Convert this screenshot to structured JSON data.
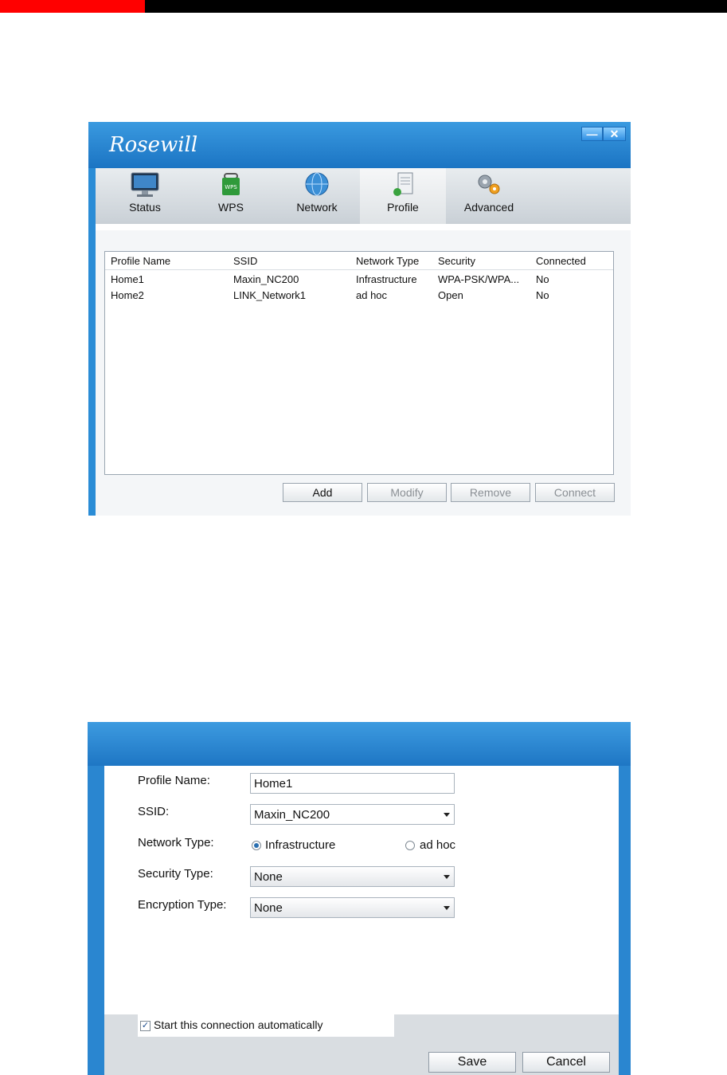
{
  "window1": {
    "brand": "Rosewill",
    "tabs": [
      {
        "label": "Status",
        "icon": "monitor-icon"
      },
      {
        "label": "WPS",
        "icon": "wps-icon"
      },
      {
        "label": "Network",
        "icon": "globe-icon"
      },
      {
        "label": "Profile",
        "icon": "profile-icon"
      },
      {
        "label": "Advanced",
        "icon": "gears-icon"
      }
    ],
    "active_tab": "Profile",
    "columns": [
      "Profile Name",
      "SSID",
      "Network Type",
      "Security",
      "Connected"
    ],
    "rows": [
      [
        "Home1",
        "Maxin_NC200",
        "Infrastructure",
        "WPA-PSK/WPA...",
        "No"
      ],
      [
        "Home2",
        "LINK_Network1",
        "ad hoc",
        "Open",
        "No"
      ]
    ],
    "buttons": {
      "add": "Add",
      "modify": "Modify",
      "remove": "Remove",
      "connect": "Connect"
    }
  },
  "window2": {
    "profile_name_label": "Profile Name:",
    "profile_name_value": "Home1",
    "ssid_label": "SSID:",
    "ssid_value": "Maxin_NC200",
    "network_type_label": "Network Type:",
    "network_type_infra": "Infrastructure",
    "network_type_adhoc": "ad hoc",
    "security_type_label": "Security Type:",
    "security_type_value": "None",
    "encryption_type_label": "Encryption Type:",
    "encryption_type_value": "None",
    "auto_connect_label": "Start this connection automatically",
    "save": "Save",
    "cancel": "Cancel"
  },
  "colors": {
    "title_blue": "#2a8cd6",
    "top_red": "#ff0000"
  }
}
